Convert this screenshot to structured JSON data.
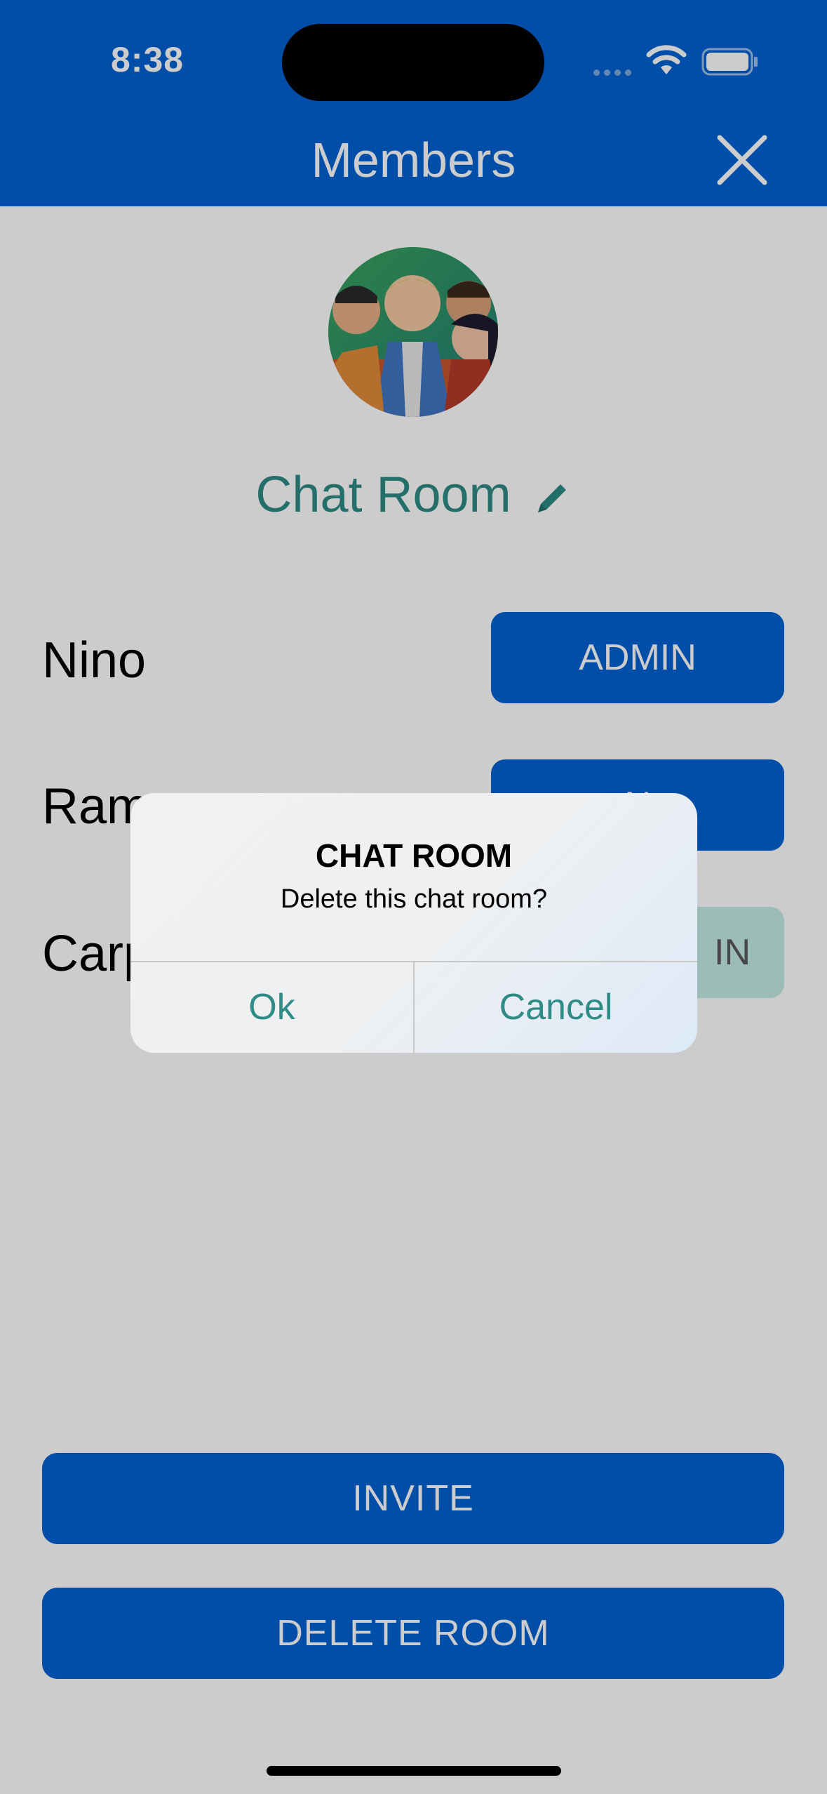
{
  "status_bar": {
    "time": "8:38"
  },
  "nav": {
    "title": "Members",
    "close_icon": "close-icon"
  },
  "room": {
    "name": "Chat Room",
    "edit_icon": "pencil-icon"
  },
  "members": [
    {
      "name": "Nino",
      "role_label": "ADMIN"
    },
    {
      "name": "Ram",
      "role_label": "N"
    },
    {
      "name": "Carp",
      "role_label": "IN"
    }
  ],
  "actions": {
    "invite_label": "INVITE",
    "delete_label": "DELETE ROOM"
  },
  "dialog": {
    "title": "CHAT ROOM",
    "message": "Delete this chat room?",
    "ok_label": "Ok",
    "cancel_label": "Cancel"
  },
  "colors": {
    "primary": "#0062d1",
    "accent": "#2e8b85",
    "pale_button": "#c4ece6"
  }
}
